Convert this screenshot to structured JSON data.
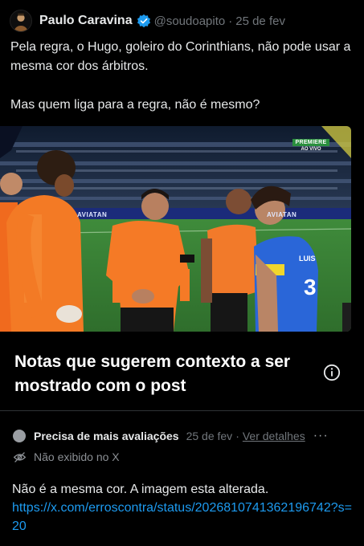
{
  "tweet": {
    "author": {
      "display_name": "Paulo Caravina",
      "handle": "@soudoapito",
      "verified": true,
      "avatar_icon": "avatar-photo"
    },
    "separator": "·",
    "date": "25 de fev",
    "text_paragraph_1": "Pela regra, o Hugo, goleiro do Corinthians, não pode usar a mesma cor dos árbitros.",
    "text_paragraph_2": "Mas quem liga para a regra, não é mesmo?",
    "media": {
      "broadcast_badge_top": "PREMIERE",
      "broadcast_badge_bottom": "AO VIVO",
      "ad_boards": [
        "AVIATAN",
        "AVIATAN"
      ],
      "player_jersey_text": "LUIS"
    }
  },
  "note": {
    "title": "Notas que sugerem contexto a ser mostrado com o post",
    "status_label": "Precisa de mais avaliações",
    "date": "25 de fev",
    "separator": "·",
    "view_details_label": "Ver detalhes",
    "more_icon": "···",
    "not_shown_label": "Não exibido no X",
    "body_text": "Não é a mesma cor. A imagem esta alterada.",
    "link_text": "https://x.com/erroscontra/status/2026810741362196742?s=20"
  },
  "colors": {
    "background": "#000000",
    "text_primary": "#e7e9ea",
    "text_secondary": "#71767b",
    "link": "#1d9bf0",
    "verified_badge": "#1d9bf0"
  }
}
